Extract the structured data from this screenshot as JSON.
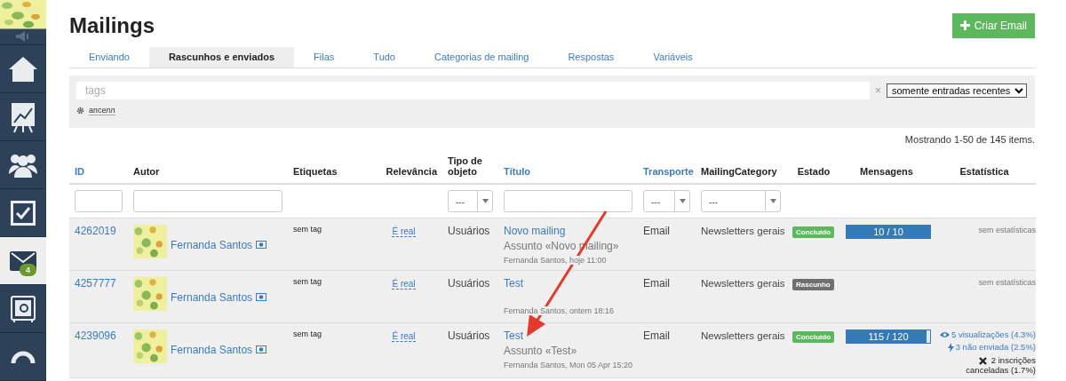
{
  "sidebar": {
    "items": [
      {
        "selected": false
      },
      {
        "selected": false
      },
      {
        "selected": false
      },
      {
        "selected": false
      },
      {
        "selected": true,
        "badge": "4"
      },
      {
        "selected": false
      },
      {
        "selected": false
      }
    ]
  },
  "page": {
    "title": "Mailings",
    "create_button": "Criar Email"
  },
  "tabs": [
    {
      "label": "Enviando",
      "selected": false
    },
    {
      "label": "Rascunhos e enviados",
      "selected": true
    },
    {
      "label": "Filas",
      "selected": false
    },
    {
      "label": "Tudo",
      "selected": false
    },
    {
      "label": "Categorias de mailing",
      "selected": false
    },
    {
      "label": "Respostas",
      "selected": false
    },
    {
      "label": "Variáveis",
      "selected": false
    }
  ],
  "filter": {
    "placeholder": "tags",
    "clear": "×",
    "scope": "somente entradas recentes",
    "saved_filter": "апселл"
  },
  "summary": "Mostrando 1-50 de 145 items.",
  "table": {
    "columns": [
      {
        "label": "ID",
        "sortable": true,
        "filter": {
          "kind": "text"
        }
      },
      {
        "label": "Autor",
        "sortable": false,
        "filter": {
          "kind": "text"
        }
      },
      {
        "label": "Etiquetas",
        "sortable": false
      },
      {
        "label": "Relevância",
        "sortable": false
      },
      {
        "label": "Tipo de objeto",
        "sortable": false,
        "filter": {
          "kind": "select"
        }
      },
      {
        "label": "Título",
        "sortable": true,
        "filter": {
          "kind": "text"
        }
      },
      {
        "label": "Transporte",
        "sortable": true,
        "filter": {
          "kind": "select"
        }
      },
      {
        "label": "MailingCategory",
        "sortable": false,
        "filter": {
          "kind": "select"
        }
      },
      {
        "label": "Estado",
        "sortable": false
      },
      {
        "label": "Mensagens",
        "sortable": false
      },
      {
        "label": "Estatística",
        "sortable": false
      }
    ],
    "select_value": "---",
    "rows": [
      {
        "id": "4262019",
        "author": "Fernanda Santos",
        "tags": "sem tag",
        "relevance": "É real",
        "type": "Usuários",
        "title": "Novo mailing",
        "subject": "Assunto «Novo mailing»",
        "meta": "Fernanda Santos, hoje 11:00",
        "transport": "Email",
        "category": "Newsletters gerais",
        "status": {
          "label": "Concluído",
          "kind": "done"
        },
        "messages": {
          "text": "10 / 10",
          "level": 1.0
        },
        "stats": [
          {
            "kind": "none",
            "text": "sem estatísticas"
          }
        ]
      },
      {
        "id": "4257777",
        "author": "Fernanda Santos",
        "tags": "sem tag",
        "relevance": "É real",
        "type": "Usuários",
        "title": "Test",
        "meta": "Fernanda Santos, ontem 18:16",
        "transport": "Email",
        "category": "Newsletters gerais",
        "status": {
          "label": "Rascunho",
          "kind": "draft"
        },
        "stats": [
          {
            "kind": "none",
            "text": "sem estatísticas"
          }
        ]
      },
      {
        "id": "4239096",
        "author": "Fernanda Santos",
        "tags": "sem tag",
        "relevance": "É real",
        "type": "Usuários",
        "title": "Test",
        "subject": "Assunto «Test»",
        "meta": "Fernanda Santos, Mon 05 Apr 15:20",
        "transport": "Email",
        "category": "Newsletters gerais",
        "status": {
          "label": "Concluído",
          "kind": "done"
        },
        "messages": {
          "text": "115 / 120",
          "level": 0.958
        },
        "stats": [
          {
            "kind": "views",
            "text": "5 visualizações (4.3%)"
          },
          {
            "kind": "unsent",
            "text": "3 não enviada (2.5%)"
          },
          {
            "kind": "unsub",
            "text": "2 inscrições canceladas (1.7%)"
          }
        ]
      }
    ]
  }
}
